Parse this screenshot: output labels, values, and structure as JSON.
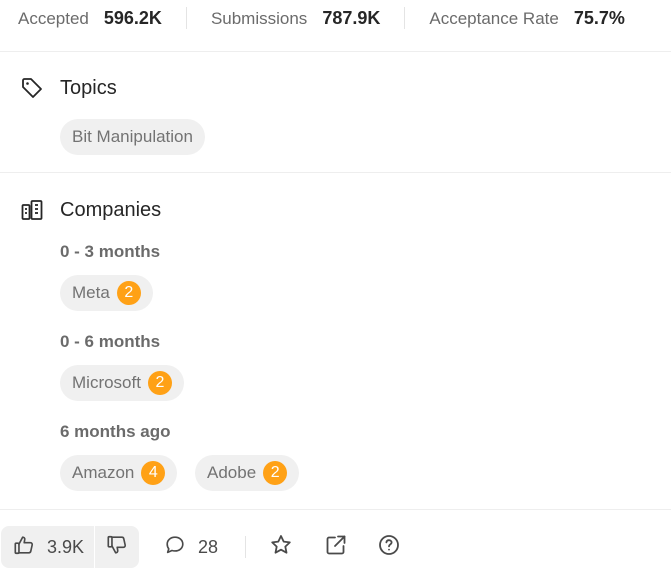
{
  "stats": {
    "accepted_label": "Accepted",
    "accepted_value": "596.2K",
    "submissions_label": "Submissions",
    "submissions_value": "787.9K",
    "rate_label": "Acceptance Rate",
    "rate_value": "75.7%"
  },
  "topics": {
    "title": "Topics",
    "icon": "tag-icon",
    "items": [
      "Bit Manipulation"
    ]
  },
  "companies": {
    "title": "Companies",
    "icon": "building-icon",
    "groups": [
      {
        "period": "0 - 3 months",
        "items": [
          {
            "name": "Meta",
            "count": "2"
          }
        ]
      },
      {
        "period": "0 - 6 months",
        "items": [
          {
            "name": "Microsoft",
            "count": "2"
          }
        ]
      },
      {
        "period": "6 months ago",
        "items": [
          {
            "name": "Amazon",
            "count": "4"
          },
          {
            "name": "Adobe",
            "count": "2"
          }
        ]
      }
    ]
  },
  "actions": {
    "likes": "3.9K",
    "comments": "28",
    "icons": [
      "thumbs-up-icon",
      "thumbs-down-icon",
      "comment-icon",
      "star-icon",
      "external-link-icon",
      "help-icon"
    ]
  },
  "colors": {
    "badge": "#ffa116",
    "chip_bg": "#f0f0f0",
    "divider": "#eeeeee"
  }
}
